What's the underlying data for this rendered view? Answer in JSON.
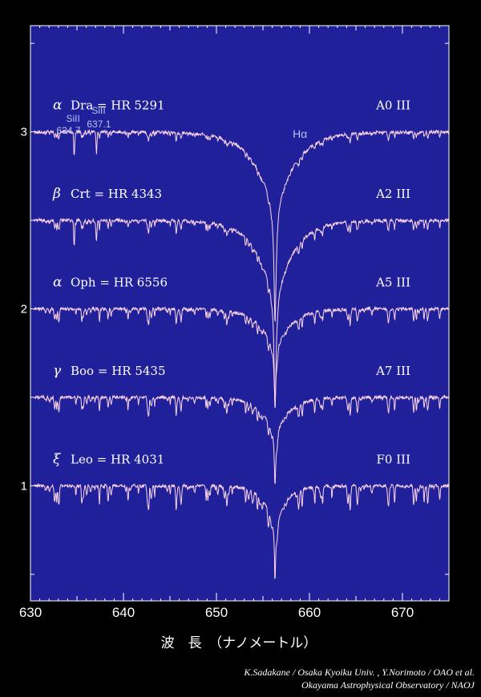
{
  "colors": {
    "background": "#000000",
    "plot_background": "#20209a",
    "trace": "#ffd6e8",
    "frame": "#ffffff"
  },
  "chart_data": {
    "type": "line",
    "xlabel": "波　長　（ナノメートル）",
    "ylabel": "",
    "xlim": [
      630,
      675
    ],
    "ylim": [
      0.35,
      3.6
    ],
    "xticks": [
      630,
      640,
      650,
      660,
      670
    ],
    "yticks": [
      1,
      2,
      3
    ],
    "grid": false,
    "series": [
      {
        "name": "α Dra = HR 5291",
        "greek": "α",
        "star": "Dra = HR 5291",
        "spectral_type": "A0 III",
        "baseline": 3.0,
        "line_depth": 0.02,
        "halpha_depth": 1.08,
        "halpha_width": 2.2
      },
      {
        "name": "β Crt = HR 4343",
        "greek": "β",
        "star": "Crt = HR 4343",
        "spectral_type": "A2 III",
        "baseline": 2.5,
        "line_depth": 0.03,
        "halpha_depth": 1.08,
        "halpha_width": 2.0
      },
      {
        "name": "α Oph = HR 6556",
        "greek": "α",
        "star": "Oph = HR 6556",
        "spectral_type": "A5 III",
        "baseline": 2.0,
        "line_depth": 0.04,
        "halpha_depth": 0.55,
        "halpha_width": 1.7
      },
      {
        "name": "γ Boo = HR 5435",
        "greek": "γ",
        "star": "Boo = HR 5435",
        "spectral_type": "A7 III",
        "baseline": 1.5,
        "line_depth": 0.045,
        "halpha_depth": 0.5,
        "halpha_width": 1.5
      },
      {
        "name": "ξ Leo = HR 4031",
        "greek": "ξ",
        "star": "Leo = HR 4031",
        "spectral_type": "F0 III",
        "baseline": 1.0,
        "line_depth": 0.06,
        "halpha_depth": 0.55,
        "halpha_width": 1.2
      }
    ],
    "annotations": [
      {
        "text": "SiII",
        "text2": "634.7",
        "x": 634.7
      },
      {
        "text": "SiII",
        "text2": "637.1",
        "x": 637.1
      },
      {
        "text": "Hα",
        "x": 656.3
      }
    ]
  },
  "credit": {
    "line1": "K.Sadakane / Osaka Kyoiku Univ. , Y.Norimoto / OAO et al.",
    "line2": "Okayama Astrophysical Observatory / NAOJ"
  }
}
